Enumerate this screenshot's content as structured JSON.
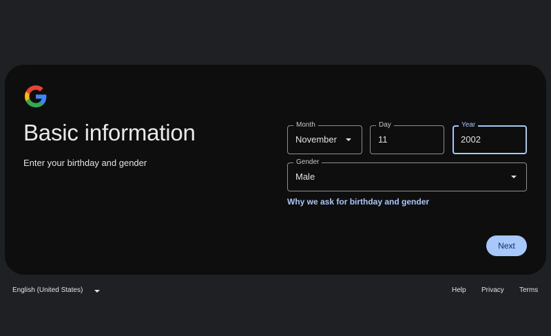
{
  "header": {
    "logo": "google-g-logo",
    "title": "Basic information",
    "subtitle": "Enter your birthday and gender"
  },
  "form": {
    "month": {
      "label": "Month",
      "value": "November",
      "icon": "chevron-down-icon"
    },
    "day": {
      "label": "Day",
      "value": "11"
    },
    "year": {
      "label": "Year",
      "value": "2002",
      "focused": true
    },
    "gender": {
      "label": "Gender",
      "value": "Male",
      "icon": "chevron-down-icon"
    },
    "why_link": "Why we ask for birthday and gender",
    "next_label": "Next"
  },
  "footer": {
    "language": "English (United States)",
    "help": "Help",
    "privacy": "Privacy",
    "terms": "Terms"
  },
  "colors": {
    "page_bg": "#1f2023",
    "card_bg": "#0e0e0f",
    "accent": "#a8c7fa",
    "button_text": "#062e6f",
    "field_border": "#8e918f"
  }
}
